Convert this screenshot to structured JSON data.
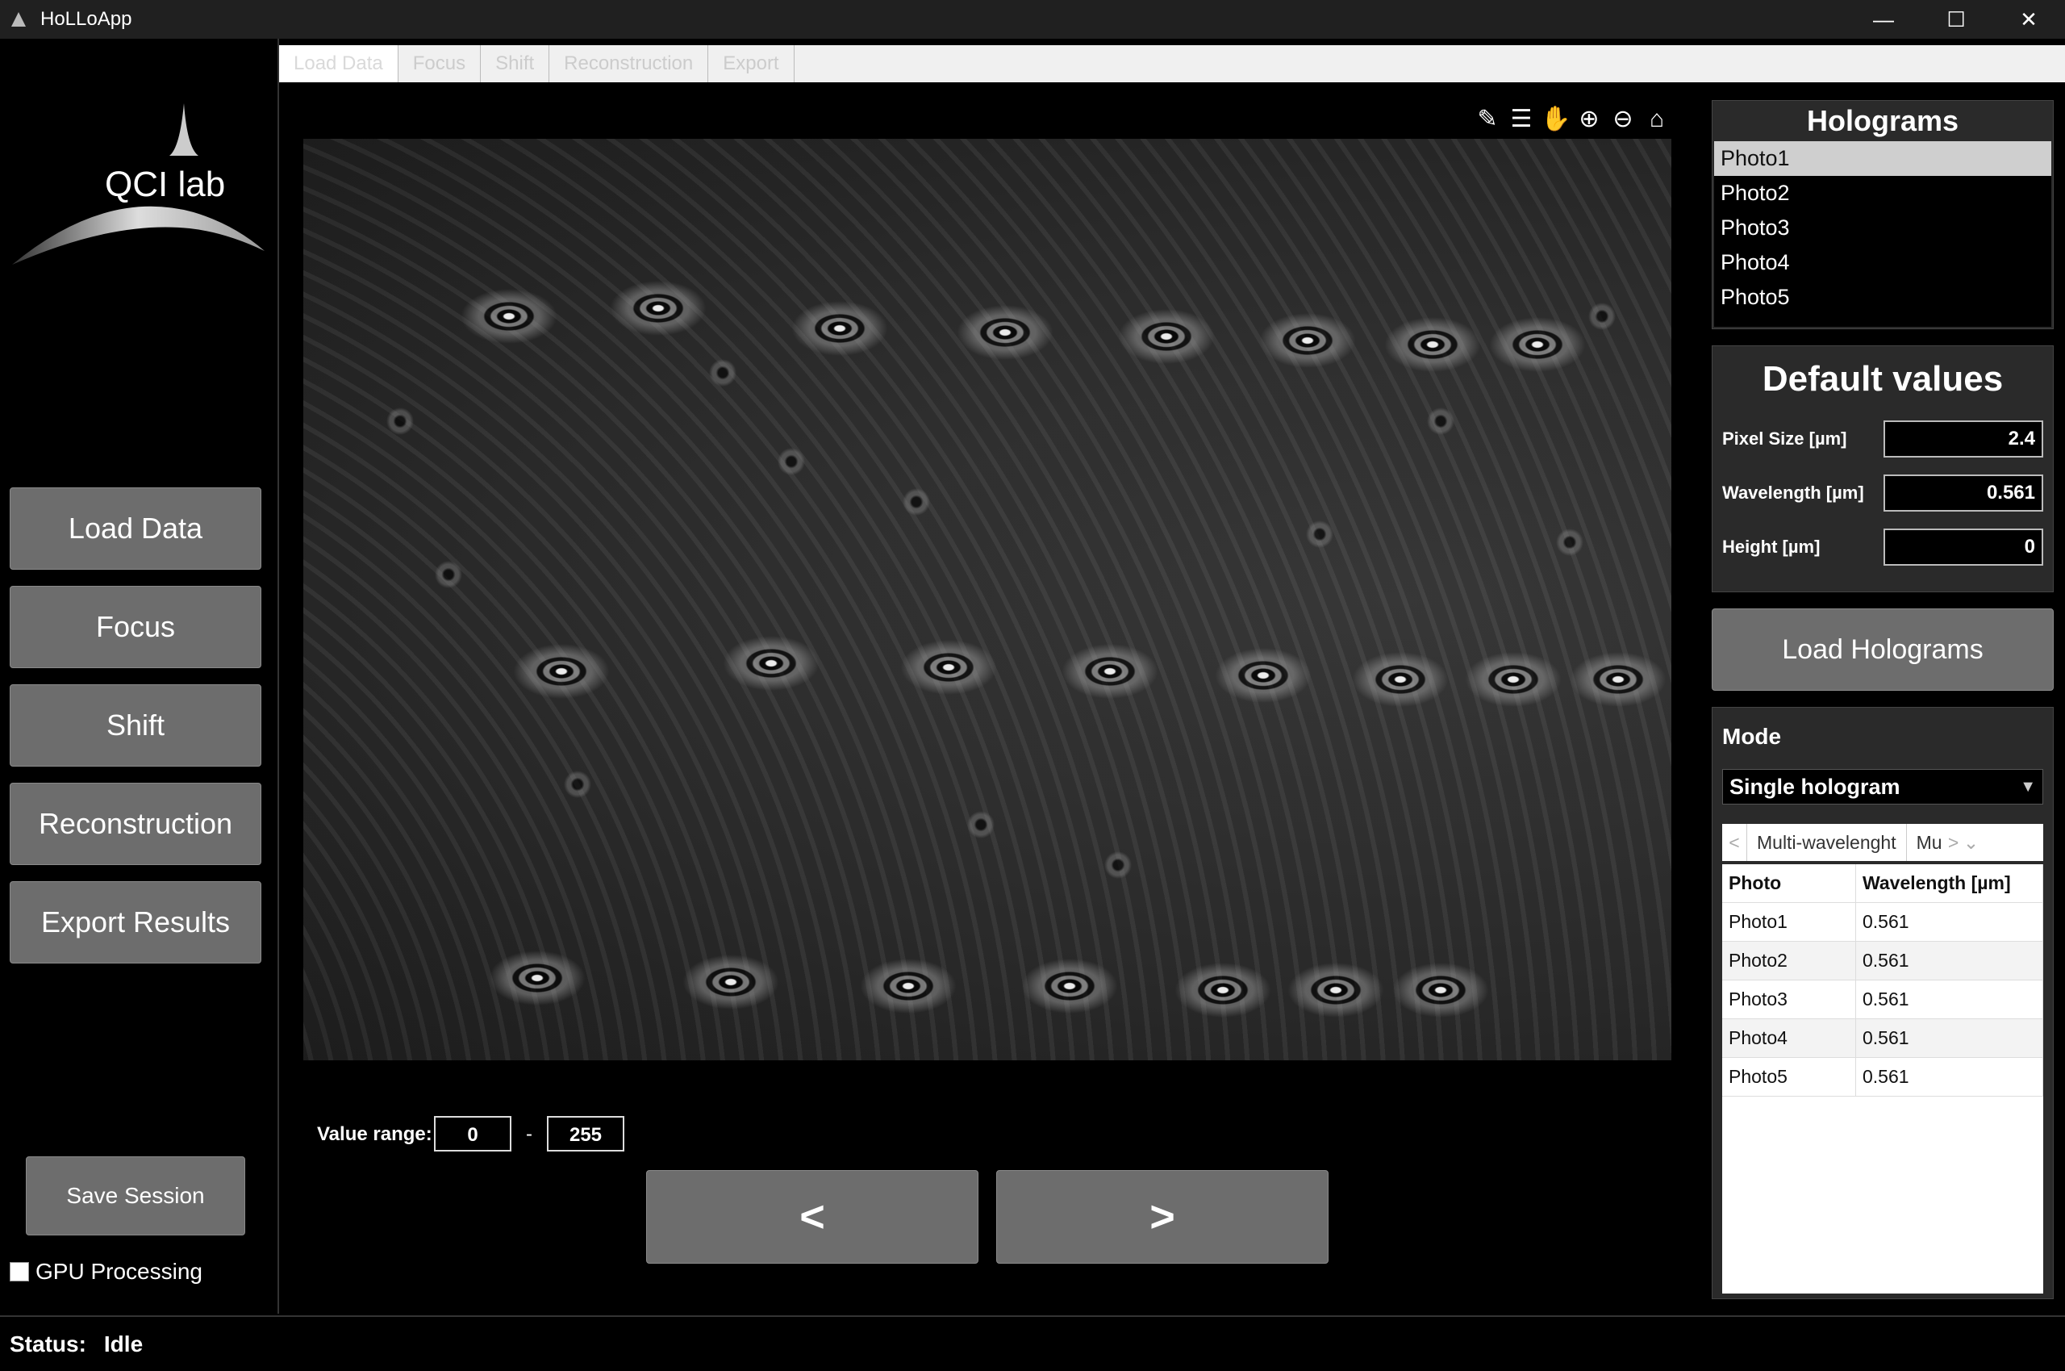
{
  "window": {
    "title": "HoLLoApp",
    "controls": {
      "minimize": "—",
      "maximize": "☐",
      "close": "✕"
    }
  },
  "tabs": [
    {
      "label": "Load Data",
      "active": true
    },
    {
      "label": "Focus"
    },
    {
      "label": "Shift"
    },
    {
      "label": "Reconstruction"
    },
    {
      "label": "Export"
    }
  ],
  "sidebar": {
    "logo_text": "QCI lab",
    "nav": [
      {
        "id": "load-data",
        "label": "Load Data"
      },
      {
        "id": "focus",
        "label": "Focus"
      },
      {
        "id": "shift",
        "label": "Shift"
      },
      {
        "id": "reconstruction",
        "label": "Reconstruction"
      },
      {
        "id": "export-results",
        "label": "Export Results"
      }
    ],
    "save_session": "Save Session",
    "gpu_label": "GPU Processing",
    "gpu_checked": false
  },
  "toolbar": {
    "icons": [
      "edit-icon",
      "subplots-icon",
      "pan-icon",
      "zoom-in-icon",
      "zoom-out-icon",
      "home-icon"
    ]
  },
  "value_range": {
    "label": "Value range:",
    "min": "0",
    "dash": "-",
    "max": "255"
  },
  "nav_arrows": {
    "prev": "<",
    "next": ">"
  },
  "holograms": {
    "title": "Holograms",
    "items": [
      "Photo1",
      "Photo2",
      "Photo3",
      "Photo4",
      "Photo5"
    ],
    "selected": "Photo1"
  },
  "defaults": {
    "title": "Default values",
    "pixel_size_label": "Pixel Size  [µm]",
    "pixel_size": "2.4",
    "wavelength_label": "Wavelength [µm]",
    "wavelength": "0.561",
    "height_label": "Height     [µm]",
    "height": "0"
  },
  "load_holograms": "Load Holograms",
  "mode": {
    "label": "Mode",
    "selected": "Single hologram",
    "subtab_left": "<",
    "subtab_main": "Multi-wavelenght",
    "subtab_second": "Mu",
    "subtab_right": ">",
    "subtab_menu": "⌄",
    "table_headers": [
      "Photo",
      "Wavelength [µm]"
    ],
    "rows": [
      [
        "Photo1",
        "0.561"
      ],
      [
        "Photo2",
        "0.561"
      ],
      [
        "Photo3",
        "0.561"
      ],
      [
        "Photo4",
        "0.561"
      ],
      [
        "Photo5",
        "0.561"
      ]
    ]
  },
  "status": {
    "label": "Status:",
    "value": "Idle"
  }
}
